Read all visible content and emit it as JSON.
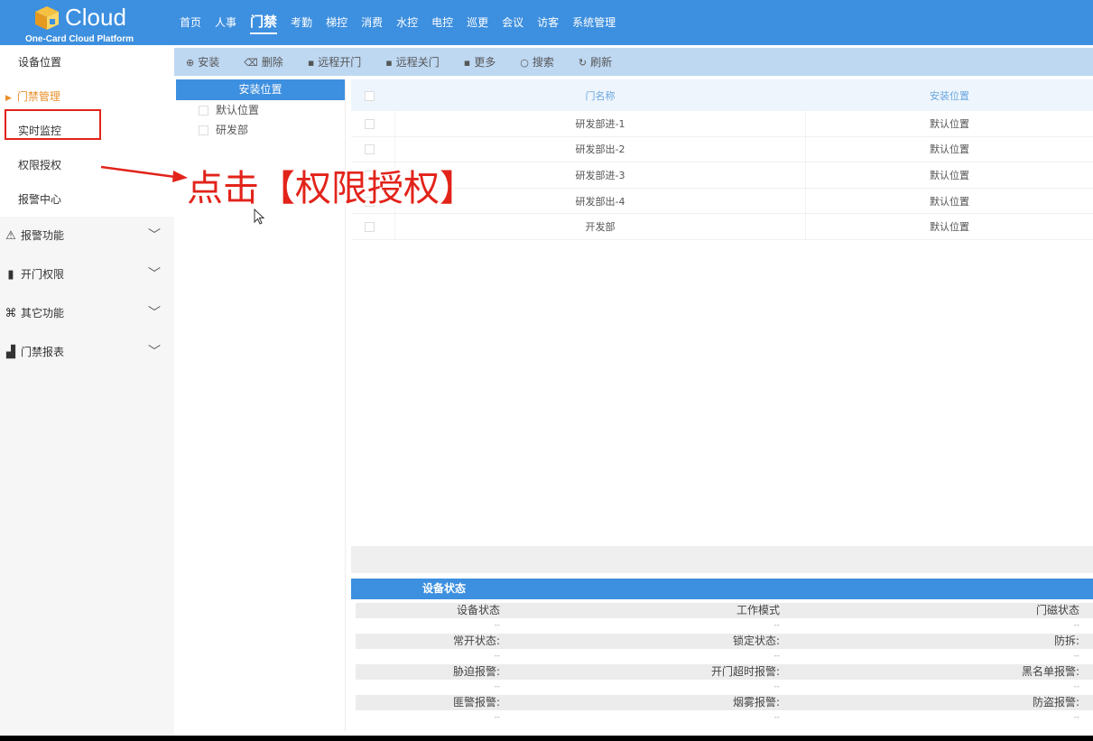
{
  "logo": {
    "brand": "Cloud",
    "subtitle": "One-Card Cloud Platform"
  },
  "topnav": [
    {
      "label": "首页",
      "active": false
    },
    {
      "label": "人事",
      "active": false
    },
    {
      "label": "门禁",
      "active": true
    },
    {
      "label": "考勤",
      "active": false
    },
    {
      "label": "梯控",
      "active": false
    },
    {
      "label": "消费",
      "active": false
    },
    {
      "label": "水控",
      "active": false
    },
    {
      "label": "电控",
      "active": false
    },
    {
      "label": "巡更",
      "active": false
    },
    {
      "label": "会议",
      "active": false
    },
    {
      "label": "访客",
      "active": false
    },
    {
      "label": "系统管理",
      "active": false
    }
  ],
  "sidebar": {
    "items": [
      {
        "label": "设备位置"
      },
      {
        "label": "门禁管理",
        "current": true
      },
      {
        "label": "实时监控"
      },
      {
        "label": "权限授权",
        "highlighted": true
      },
      {
        "label": "报警中心"
      }
    ],
    "groups": [
      {
        "label": "报警功能",
        "icon": "alarm-icon"
      },
      {
        "label": "开门权限",
        "icon": "door-icon"
      },
      {
        "label": "其它功能",
        "icon": "command-icon"
      },
      {
        "label": "门禁报表",
        "icon": "chart-icon"
      }
    ]
  },
  "toolbar": [
    {
      "label": "安装",
      "icon": "plus-circle-icon"
    },
    {
      "label": "删除",
      "icon": "trash-icon"
    },
    {
      "label": "远程开门",
      "icon": "square-icon"
    },
    {
      "label": "远程关门",
      "icon": "square-icon"
    },
    {
      "label": "更多",
      "icon": "square-icon"
    },
    {
      "label": "搜索",
      "icon": "search-icon"
    },
    {
      "label": "刷新",
      "icon": "refresh-icon"
    }
  ],
  "location_panel": {
    "title": "安装位置",
    "items": [
      "默认位置",
      "研发部"
    ]
  },
  "door_table": {
    "columns": [
      "门名称",
      "安装位置"
    ],
    "rows": [
      [
        "研发部进-1",
        "默认位置"
      ],
      [
        "研发部出-2",
        "默认位置"
      ],
      [
        "研发部进-3",
        "默认位置"
      ],
      [
        "研发部出-4",
        "默认位置"
      ],
      [
        "开发部",
        "默认位置"
      ]
    ]
  },
  "device_status": {
    "title": "设备状态",
    "rows": [
      [
        "设备状态",
        "工作模式",
        "门磁状态"
      ],
      [
        "常开状态:",
        "锁定状态:",
        "防拆:"
      ],
      [
        "胁迫报警:",
        "开门超时报警:",
        "黑名单报警:"
      ],
      [
        "匪警报警:",
        "烟雾报警:",
        "防盗报警:"
      ]
    ],
    "placeholder": "--"
  },
  "annotation": {
    "text": "点击【权限授权】",
    "color": "#e2231a"
  },
  "colors": {
    "accent": "#3d8fdf",
    "toolbar": "#bed8f2",
    "current": "#e8912c"
  }
}
